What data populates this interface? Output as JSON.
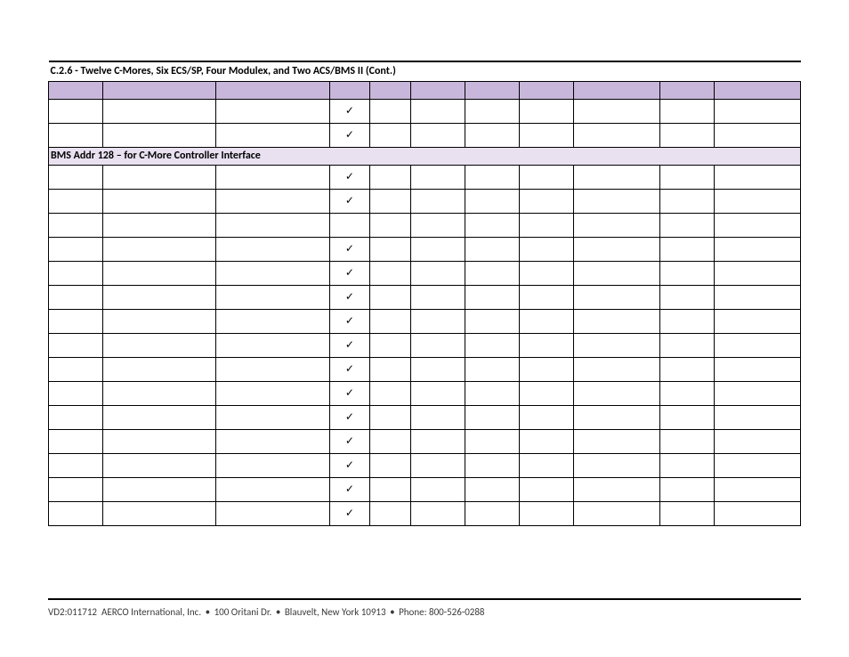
{
  "title": "C.2.6 - Twelve C-Mores, Six ECS/SP, Four Modulex, and Two ACS/BMS II (Cont.)",
  "subheader": "BMS Addr 128 – for C-More Controller Interface",
  "check_glyph": "✓",
  "rows_before_subheader": [
    {
      "p4": true
    },
    {
      "p4": true
    }
  ],
  "rows_after_subheader": [
    {
      "p4": true
    },
    {
      "p4": true
    },
    {
      "p4": false
    },
    {
      "p4": true
    },
    {
      "p4": true
    },
    {
      "p4": true
    },
    {
      "p4": true
    },
    {
      "p4": true
    },
    {
      "p4": true
    },
    {
      "p4": true
    },
    {
      "p4": true
    },
    {
      "p4": true
    },
    {
      "p4": true
    },
    {
      "p4": true
    },
    {
      "p4": true
    }
  ],
  "footer": {
    "code": "VD2:011712",
    "company": "AERCO International, Inc.",
    "addr1": "100 Oritani Dr.",
    "addr2": "Blauvelt, New York 10913",
    "phone": "Phone: 800-526-0288"
  }
}
